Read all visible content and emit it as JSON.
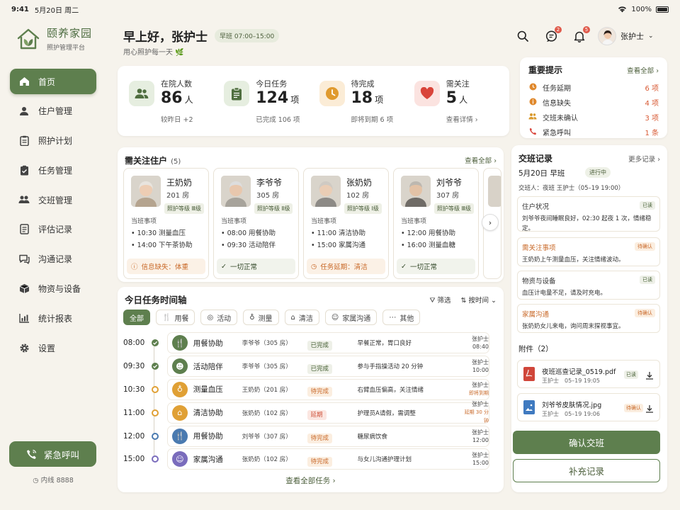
{
  "status_bar": {
    "time": "9:41",
    "date": "5月20日 周二",
    "battery": "100%"
  },
  "brand": {
    "name": "颐养家园",
    "subtitle": "照护管理平台"
  },
  "nav": [
    {
      "label": "首页",
      "icon": "home-icon",
      "active": true
    },
    {
      "label": "住户管理",
      "icon": "user-icon"
    },
    {
      "label": "照护计划",
      "icon": "clipboard-icon"
    },
    {
      "label": "任务管理",
      "icon": "task-icon"
    },
    {
      "label": "交班管理",
      "icon": "handover-icon"
    },
    {
      "label": "评估记录",
      "icon": "assessment-icon"
    },
    {
      "label": "沟通记录",
      "icon": "chat-icon"
    },
    {
      "label": "物资与设备",
      "icon": "box-icon"
    },
    {
      "label": "统计报表",
      "icon": "chart-icon"
    },
    {
      "label": "设置",
      "icon": "gear-icon"
    }
  ],
  "emergency": {
    "label": "紧急呼叫",
    "hotline": "内线 8888"
  },
  "header": {
    "greeting": "早上好，张护士",
    "shift": "早班 07:00–15:00",
    "subtitle": "用心照护每一天",
    "messages_badge": "2",
    "notifications_badge": "5",
    "user_name": "张护士"
  },
  "stats": [
    {
      "label": "在院人数",
      "value": "86",
      "unit": "人",
      "note": "较昨日 +2",
      "color": "#e6eee0"
    },
    {
      "label": "今日任务",
      "value": "124",
      "unit": "项",
      "note": "已完成 106 项",
      "color": "#e6eee0"
    },
    {
      "label": "待完成",
      "value": "18",
      "unit": "项",
      "note": "即将到期 6 项",
      "color": "#fbecd6"
    },
    {
      "label": "需关注",
      "value": "5",
      "unit": "人",
      "note": "查看详情",
      "color": "#fbe3e0"
    }
  ],
  "alerts": {
    "title": "重要提示",
    "view_all": "查看全部",
    "items": [
      {
        "label": "任务延期",
        "count": "6 项",
        "icon": "clock-icon"
      },
      {
        "label": "信息缺失",
        "count": "4 项",
        "icon": "info-icon"
      },
      {
        "label": "交班未确认",
        "count": "3 项",
        "icon": "people-icon"
      },
      {
        "label": "紧急呼叫",
        "count": "1 条",
        "icon": "phone-icon"
      }
    ]
  },
  "focus": {
    "title": "需关注住户",
    "count": "(5)",
    "view_all": "查看全部",
    "duty_label": "当班事项",
    "residents": [
      {
        "name": "王奶奶",
        "room": "201 房",
        "level": "照护等级 Ⅲ级",
        "tasks": [
          "10:30 测量血压",
          "14:00 下午茶协助"
        ],
        "status": "信息缺失：体重",
        "status_type": "warn"
      },
      {
        "name": "李爷爷",
        "room": "305 房",
        "level": "照护等级 Ⅱ级",
        "tasks": [
          "08:00 用餐协助",
          "09:30 活动陪伴"
        ],
        "status": "一切正常",
        "status_type": "ok"
      },
      {
        "name": "张奶奶",
        "room": "102 房",
        "level": "照护等级 Ⅰ级",
        "tasks": [
          "11:00 清洁协助",
          "15:00 家属沟通"
        ],
        "status": "任务延期：清洁",
        "status_type": "warn"
      },
      {
        "name": "刘爷爷",
        "room": "307 房",
        "level": "照护等级 Ⅲ级",
        "tasks": [
          "12:00 用餐协助",
          "16:00 测量血糖"
        ],
        "status": "一切正常",
        "status_type": "ok"
      }
    ]
  },
  "timeline": {
    "title": "今日任务时间轴",
    "filter": "筛选",
    "sort": "按时间",
    "chips": [
      "全部",
      "用餐",
      "活动",
      "测量",
      "清洁",
      "家属沟通",
      "其他"
    ],
    "rows": [
      {
        "time": "08:00",
        "task": "用餐协助",
        "who": "李爷爷（305 房）",
        "status": "已完成",
        "status_type": "done",
        "note": "早餐正常，胃口良好",
        "nurse": "张护士",
        "extra": "08:40",
        "dot": "done",
        "icon_color": "#5e7f4e"
      },
      {
        "time": "09:30",
        "task": "活动陪伴",
        "who": "李爷爷（305 房）",
        "status": "已完成",
        "status_type": "done",
        "note": "参与手指操活动 20 分钟",
        "nurse": "张护士",
        "extra": "10:00",
        "dot": "done",
        "icon_color": "#5e7f4e"
      },
      {
        "time": "10:30",
        "task": "测量血压",
        "who": "王奶奶（201 房）",
        "status": "待完成",
        "status_type": "wait",
        "note": "右臂血压偏高，关注情绪",
        "nurse": "张护士",
        "extra": "即将到期",
        "dot": "pending",
        "icon_color": "#e0a035"
      },
      {
        "time": "11:00",
        "task": "清洁协助",
        "who": "张奶奶（102 房）",
        "status": "延期",
        "status_type": "late",
        "note": "护理员A请假，需调整",
        "nurse": "张护士",
        "extra": "延期 30 分钟",
        "dot": "pending",
        "icon_color": "#e0a035"
      },
      {
        "time": "12:00",
        "task": "用餐协助",
        "who": "刘爷爷（307 房）",
        "status": "待完成",
        "status_type": "wait",
        "note": "糖尿病饮食",
        "nurse": "张护士",
        "extra": "12:00",
        "dot": "future",
        "icon_color": "#4a7ab0"
      },
      {
        "time": "15:00",
        "task": "家属沟通",
        "who": "张奶奶（102 房）",
        "status": "待完成",
        "status_type": "wait",
        "note": "与女儿沟通护理计划",
        "nurse": "张护士",
        "extra": "15:00",
        "dot": "future2",
        "icon_color": "#7a6cbc"
      }
    ],
    "view_all": "查看全部任务"
  },
  "handover": {
    "title": "交班记录",
    "more": "更多记录",
    "date": "5月20日 早班",
    "status": "进行中",
    "handover_person": "交班人：夜班 王护士（05–19 19:00）",
    "notes": [
      {
        "title": "住户状况",
        "tag": "已读",
        "tag_type": "read",
        "body": "刘爷爷夜间睡眠良好，02:30 起夜 1 次，情绪稳定。",
        "orange": false
      },
      {
        "title": "需关注事项",
        "tag": "待确认",
        "tag_type": "wait",
        "body": "王奶奶上午测量血压，关注情绪波动。",
        "orange": true
      },
      {
        "title": "物资与设备",
        "tag": "已读",
        "tag_type": "read",
        "body": "血压计电量不足，请及时充电。",
        "orange": false
      },
      {
        "title": "家属沟通",
        "tag": "待确认",
        "tag_type": "wait",
        "body": "张奶奶女儿来电，询问周末探视事宜。",
        "orange": true
      }
    ],
    "attachments_title": "附件（2）",
    "files": [
      {
        "name": "夜班巡查记录_0519.pdf",
        "meta": "王护士　05–19 19:05",
        "tag": "已读",
        "tag_type": "read",
        "color": "#d0463a"
      },
      {
        "name": "刘爷爷皮肤情况.jpg",
        "meta": "王护士　05–19 19:06",
        "tag": "待确认",
        "tag_type": "wait",
        "color": "#3f7ac0"
      }
    ],
    "confirm": "确认交班",
    "supplement": "补充记录"
  }
}
